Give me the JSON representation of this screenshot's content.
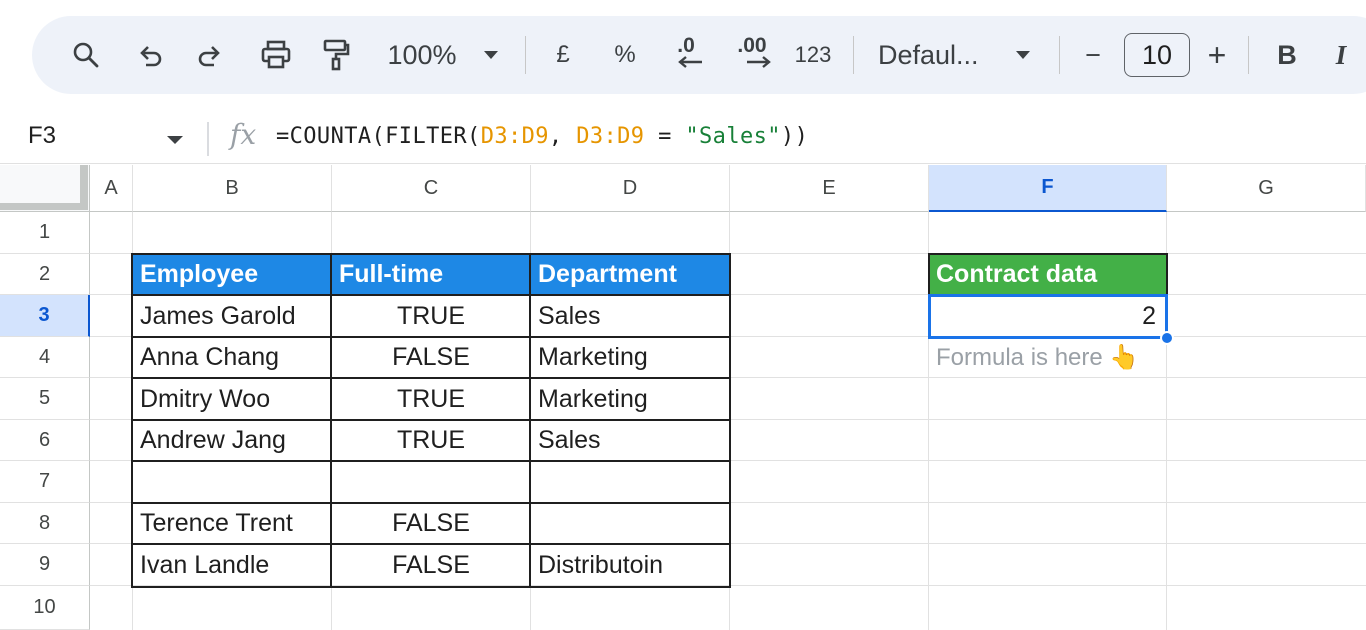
{
  "toolbar": {
    "zoom": "100%",
    "currency": "£",
    "percent": "%",
    "decrease_decimals": ".0",
    "increase_decimals": ".00",
    "number_format": "123",
    "font": "Defaul...",
    "font_size": "10",
    "minus": "−",
    "plus": "+",
    "bold": "B",
    "italic": "I"
  },
  "formula_bar": {
    "cell_ref": "F3",
    "fx": "fx",
    "formula_prefix": "=COUNTA(FILTER(",
    "ref1": "D3:D9",
    "comma": ", ",
    "ref2": "D3:D9",
    "eq": " = ",
    "str": "\"Sales\"",
    "suffix": "))"
  },
  "columns": [
    "A",
    "B",
    "C",
    "D",
    "E",
    "F",
    "G"
  ],
  "rows": [
    "1",
    "2",
    "3",
    "4",
    "5",
    "6",
    "7",
    "8",
    "9",
    "10"
  ],
  "table": {
    "headers": [
      "Employee",
      "Full-time",
      "Department"
    ],
    "rows": [
      [
        "James Garold",
        "TRUE",
        "Sales"
      ],
      [
        "Anna Chang",
        "FALSE",
        "Marketing"
      ],
      [
        "Dmitry Woo",
        "TRUE",
        "Marketing"
      ],
      [
        "Andrew Jang",
        "TRUE",
        "Sales"
      ],
      [
        "",
        "",
        ""
      ],
      [
        "Terence Trent",
        "FALSE",
        ""
      ],
      [
        "Ivan Landle",
        "FALSE",
        "Distributoin"
      ]
    ]
  },
  "result": {
    "header": "Contract data",
    "value": "2",
    "note": "Formula is here 👆"
  },
  "colors": {
    "header_blue": "#1e88e5",
    "header_green": "#43b047",
    "selection": "#1a73e8",
    "formula_ref": "#e69500",
    "formula_string": "#188038"
  }
}
